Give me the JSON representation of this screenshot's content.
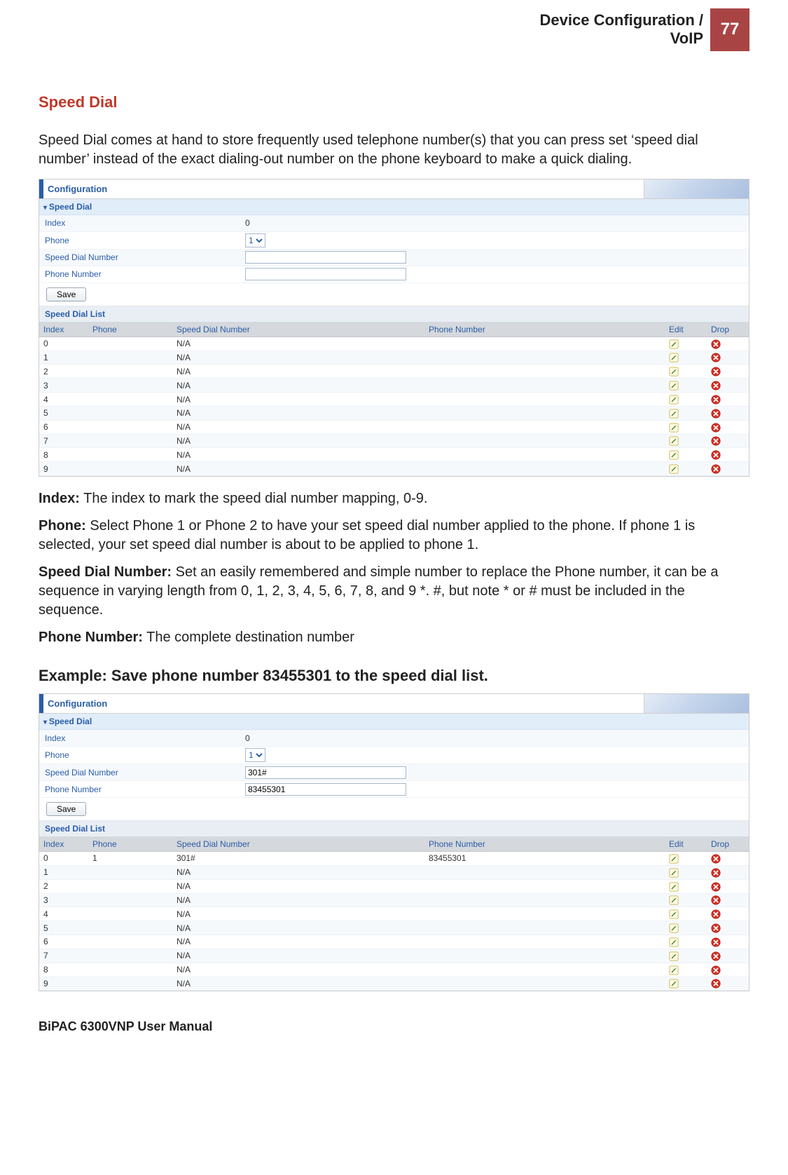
{
  "header": {
    "title_line1": "Device Configuration /",
    "title_line2": "VoIP",
    "page_number": "77"
  },
  "section": {
    "title": "Speed Dial",
    "intro": "Speed Dial comes at hand to store frequently used telephone number(s) that you can press set ‘speed dial number’ instead of the exact dialing-out number on the phone keyboard to make a quick dialing."
  },
  "panel1": {
    "topbar": "Configuration",
    "subheader": "Speed Dial",
    "form": {
      "index_label": "Index",
      "index_value": "0",
      "phone_label": "Phone",
      "phone_selected": "1",
      "sdn_label": "Speed Dial Number",
      "sdn_value": "",
      "pn_label": "Phone Number",
      "pn_value": ""
    },
    "save_label": "Save",
    "list_title": "Speed Dial List",
    "columns": {
      "index": "Index",
      "phone": "Phone",
      "sdn": "Speed Dial Number",
      "pn": "Phone Number",
      "edit": "Edit",
      "drop": "Drop"
    },
    "rows": [
      {
        "index": "0",
        "phone": "",
        "sdn": "N/A",
        "pn": ""
      },
      {
        "index": "1",
        "phone": "",
        "sdn": "N/A",
        "pn": ""
      },
      {
        "index": "2",
        "phone": "",
        "sdn": "N/A",
        "pn": ""
      },
      {
        "index": "3",
        "phone": "",
        "sdn": "N/A",
        "pn": ""
      },
      {
        "index": "4",
        "phone": "",
        "sdn": "N/A",
        "pn": ""
      },
      {
        "index": "5",
        "phone": "",
        "sdn": "N/A",
        "pn": ""
      },
      {
        "index": "6",
        "phone": "",
        "sdn": "N/A",
        "pn": ""
      },
      {
        "index": "7",
        "phone": "",
        "sdn": "N/A",
        "pn": ""
      },
      {
        "index": "8",
        "phone": "",
        "sdn": "N/A",
        "pn": ""
      },
      {
        "index": "9",
        "phone": "",
        "sdn": "N/A",
        "pn": ""
      }
    ]
  },
  "definitions": {
    "index_label": "Index:",
    "index_text": " The index to mark the speed dial number mapping, 0-9.",
    "phone_label": "Phone:",
    "phone_text": " Select Phone 1 or Phone 2 to have your set speed dial number applied to the phone. If phone 1 is selected, your set speed dial number is about to be applied to phone 1.",
    "sdn_label": "Speed Dial Number:",
    "sdn_text": " Set an easily remembered and simple number to replace the Phone number, it can be a sequence in varying length from 0, 1, 2, 3, 4, 5, 6, 7, 8, and 9 *. #, but note * or # must be included in the sequence.",
    "pn_label": "Phone Number:",
    "pn_text": " The complete destination number"
  },
  "example_heading": "Example: Save phone number 83455301 to the speed dial list.",
  "panel2": {
    "topbar": "Configuration",
    "subheader": "Speed Dial",
    "form": {
      "index_label": "Index",
      "index_value": "0",
      "phone_label": "Phone",
      "phone_selected": "1",
      "sdn_label": "Speed Dial Number",
      "sdn_value": "301#",
      "pn_label": "Phone Number",
      "pn_value": "83455301"
    },
    "save_label": "Save",
    "list_title": "Speed Dial List",
    "columns": {
      "index": "Index",
      "phone": "Phone",
      "sdn": "Speed Dial Number",
      "pn": "Phone Number",
      "edit": "Edit",
      "drop": "Drop"
    },
    "rows": [
      {
        "index": "0",
        "phone": "1",
        "sdn": "301#",
        "pn": "83455301"
      },
      {
        "index": "1",
        "phone": "",
        "sdn": "N/A",
        "pn": ""
      },
      {
        "index": "2",
        "phone": "",
        "sdn": "N/A",
        "pn": ""
      },
      {
        "index": "3",
        "phone": "",
        "sdn": "N/A",
        "pn": ""
      },
      {
        "index": "4",
        "phone": "",
        "sdn": "N/A",
        "pn": ""
      },
      {
        "index": "5",
        "phone": "",
        "sdn": "N/A",
        "pn": ""
      },
      {
        "index": "6",
        "phone": "",
        "sdn": "N/A",
        "pn": ""
      },
      {
        "index": "7",
        "phone": "",
        "sdn": "N/A",
        "pn": ""
      },
      {
        "index": "8",
        "phone": "",
        "sdn": "N/A",
        "pn": ""
      },
      {
        "index": "9",
        "phone": "",
        "sdn": "N/A",
        "pn": ""
      }
    ]
  },
  "footer": "BiPAC 6300VNP User Manual"
}
